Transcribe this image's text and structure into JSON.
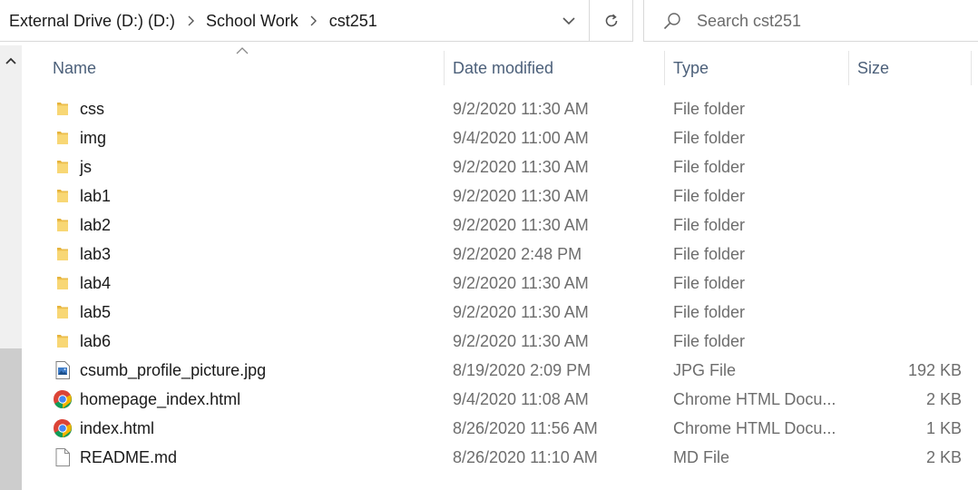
{
  "address": {
    "crumbs": [
      "External Drive (D:) (D:)",
      "School Work",
      "cst251"
    ]
  },
  "search": {
    "placeholder": "Search cst251",
    "value": ""
  },
  "columns": {
    "name": "Name",
    "date": "Date modified",
    "type": "Type",
    "size": "Size"
  },
  "files": [
    {
      "name": "css",
      "date": "9/2/2020 11:30 AM",
      "type": "File folder",
      "size": "",
      "icon": "folder-icon"
    },
    {
      "name": "img",
      "date": "9/4/2020 11:00 AM",
      "type": "File folder",
      "size": "",
      "icon": "folder-icon"
    },
    {
      "name": "js",
      "date": "9/2/2020 11:30 AM",
      "type": "File folder",
      "size": "",
      "icon": "folder-icon"
    },
    {
      "name": "lab1",
      "date": "9/2/2020 11:30 AM",
      "type": "File folder",
      "size": "",
      "icon": "folder-icon"
    },
    {
      "name": "lab2",
      "date": "9/2/2020 11:30 AM",
      "type": "File folder",
      "size": "",
      "icon": "folder-icon"
    },
    {
      "name": "lab3",
      "date": "9/2/2020 2:48 PM",
      "type": "File folder",
      "size": "",
      "icon": "folder-icon"
    },
    {
      "name": "lab4",
      "date": "9/2/2020 11:30 AM",
      "type": "File folder",
      "size": "",
      "icon": "folder-icon"
    },
    {
      "name": "lab5",
      "date": "9/2/2020 11:30 AM",
      "type": "File folder",
      "size": "",
      "icon": "folder-icon"
    },
    {
      "name": "lab6",
      "date": "9/2/2020 11:30 AM",
      "type": "File folder",
      "size": "",
      "icon": "folder-icon"
    },
    {
      "name": "csumb_profile_picture.jpg",
      "date": "8/19/2020 2:09 PM",
      "type": "JPG File",
      "size": "192 KB",
      "icon": "image-file-icon"
    },
    {
      "name": "homepage_index.html",
      "date": "9/4/2020 11:08 AM",
      "type": "Chrome HTML Docu...",
      "size": "2 KB",
      "icon": "chrome-icon"
    },
    {
      "name": "index.html",
      "date": "8/26/2020 11:56 AM",
      "type": "Chrome HTML Docu...",
      "size": "1 KB",
      "icon": "chrome-icon"
    },
    {
      "name": "README.md",
      "date": "8/26/2020 11:10 AM",
      "type": "MD File",
      "size": "2 KB",
      "icon": "document-icon"
    }
  ],
  "colors": {
    "header_text": "#4c607a",
    "secondary_text": "#6d6d6d",
    "folder": "#f8d775",
    "folder_dark": "#e6b43c"
  }
}
